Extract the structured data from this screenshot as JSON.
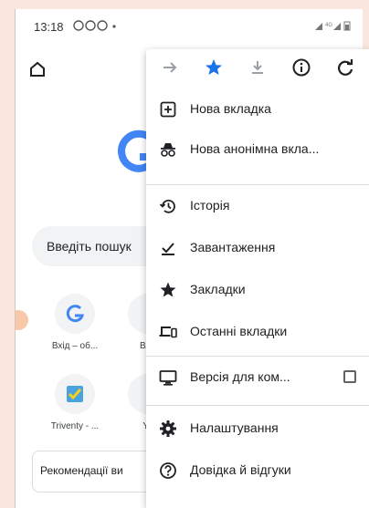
{
  "status": {
    "time": "13:18",
    "indicators": "·",
    "signal": "4G"
  },
  "page": {
    "search_placeholder": "Введіть пошук",
    "tiles": [
      {
        "label": "Вхід – об...",
        "icon": "google-g-icon"
      },
      {
        "label": "Вла",
        "icon": ""
      },
      {
        "label": "Triventy - ...",
        "icon": "triventy-check-icon"
      },
      {
        "label": "Yo",
        "icon": ""
      }
    ],
    "recommend_label": "Рекомендації ви"
  },
  "menu": {
    "toolbar": [
      {
        "name": "forward-button",
        "icon": "forward-arrow-icon"
      },
      {
        "name": "bookmark-star-button",
        "icon": "star-icon"
      },
      {
        "name": "download-button",
        "icon": "download-icon"
      },
      {
        "name": "page-info-button",
        "icon": "info-icon"
      },
      {
        "name": "reload-button",
        "icon": "reload-icon"
      }
    ],
    "items": [
      {
        "label": "Нова вкладка",
        "icon": "new-tab-icon"
      },
      {
        "label": "Нова анонімна вкла...",
        "icon": "incognito-icon"
      },
      {
        "label": "Історія",
        "icon": "history-icon"
      },
      {
        "label": "Завантаження",
        "icon": "downloads-icon"
      },
      {
        "label": "Закладки",
        "icon": "bookmarks-star-icon"
      },
      {
        "label": "Останні вкладки",
        "icon": "recent-tabs-icon"
      },
      {
        "label": "Версія для ком...",
        "icon": "desktop-icon"
      },
      {
        "label": "Налаштування",
        "icon": "settings-gear-icon"
      },
      {
        "label": "Довідка й відгуки",
        "icon": "help-icon"
      }
    ],
    "desktop_checked": false
  },
  "colors": {
    "accent_blue": "#1a73e8",
    "background": "#fbe7de"
  }
}
